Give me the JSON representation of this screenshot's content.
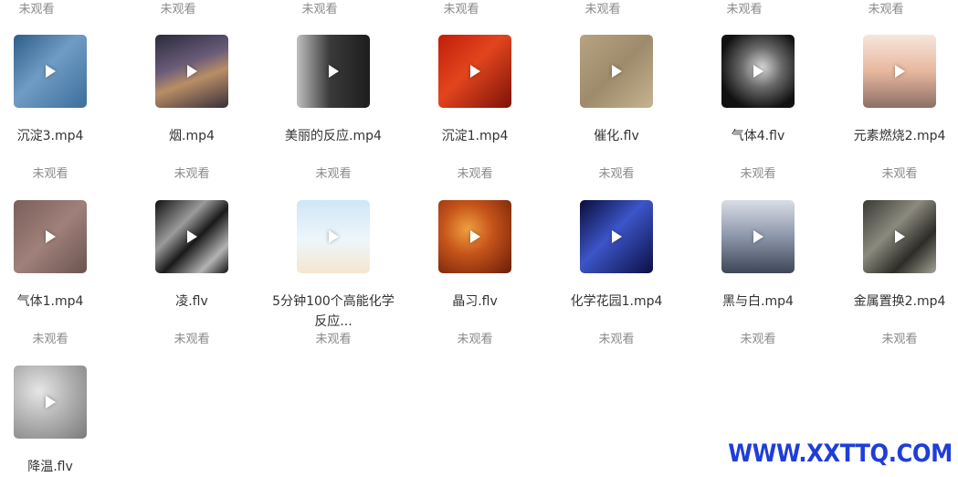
{
  "top_row_status": [
    "未观看",
    "未观看",
    "未观看",
    "未观看",
    "未观看",
    "未观看",
    "未观看"
  ],
  "files": [
    {
      "name": "沉淀3.mp4",
      "status": "未观看",
      "thumb": "linear-gradient(135deg,#2f5d8a 0%,#6f9cc4 45%,#3c6e9c 100%)"
    },
    {
      "name": "烟.mp4",
      "status": "未观看",
      "thumb": "linear-gradient(160deg,#2a2a3a 0%,#6a5c7a 40%,#b98e66 60%,#3a2f3a 100%)"
    },
    {
      "name": "美丽的反应.mp4",
      "status": "未观看",
      "thumb": "linear-gradient(90deg,#bfbfbf 0%,#3a3a3a 45%,#1d1d1d 100%)"
    },
    {
      "name": "沉淀1.mp4",
      "status": "未观看",
      "thumb": "linear-gradient(135deg,#c21e0a 0%,#e2451d 45%,#7d1209 100%)"
    },
    {
      "name": "催化.flv",
      "status": "未观看",
      "thumb": "linear-gradient(135deg,#b7a381 0%,#9e8b6b 50%,#c5b391 100%)"
    },
    {
      "name": "气体4.flv",
      "status": "未观看",
      "thumb": "radial-gradient(circle at 55% 45%,#d8d8d8 0%,#6a6a6a 35%,#111111 75%)"
    },
    {
      "name": "元素燃烧2.mp4",
      "status": "未观看",
      "thumb": "linear-gradient(180deg,#f6e6dc 0%,#e8b79e 50%,#8c6f66 100%)"
    },
    {
      "name": "气体1.mp4",
      "status": "未观看",
      "thumb": "linear-gradient(135deg,#7a5f5a 0%,#a0807a 50%,#6c5450 100%)"
    },
    {
      "name": "凌.flv",
      "status": "未观看",
      "thumb": "linear-gradient(135deg,#111111 0%,#9a9a9a 35%,#1a1a1a 55%,#b3b3b3 80%,#111111 100%)"
    },
    {
      "name": "5分钟100个高能化学反应...",
      "status": "未观看",
      "thumb": "linear-gradient(180deg,#cfe6f6 0%,#eef6fb 55%,#f4e6cf 100%)"
    },
    {
      "name": "晶习.flv",
      "status": "未观看",
      "thumb": "radial-gradient(circle at 40% 40%,#f0a040 0%,#c6541a 40%,#6b1c08 100%)"
    },
    {
      "name": "化学花园1.mp4",
      "status": "未观看",
      "thumb": "linear-gradient(135deg,#0a0d3a 0%,#3c55c8 45%,#0b0f44 100%)"
    },
    {
      "name": "黑与白.mp4",
      "status": "未观看",
      "thumb": "linear-gradient(180deg,#d9dde6 0%,#8c96aa 50%,#3e4658 100%)"
    },
    {
      "name": "金属置换2.mp4",
      "status": "未观看",
      "thumb": "linear-gradient(135deg,#3a3a33 0%,#8b8a7e 40%,#2d2c27 70%,#a3a294 100%)"
    },
    {
      "name": "降温.flv",
      "status": "",
      "thumb": "radial-gradient(circle at 35% 35%,#e6e6e6 0%,#b3b3b3 45%,#7a7a7a 100%)"
    }
  ],
  "watermark": "WWW.XXTTQ.COM",
  "icons": {
    "play": "play-icon"
  }
}
